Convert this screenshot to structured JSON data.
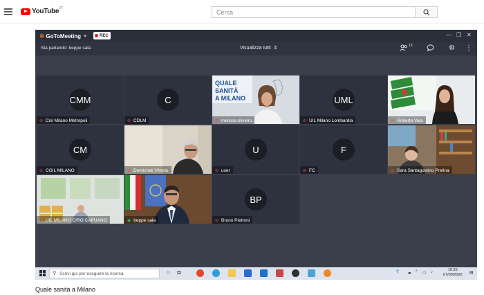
{
  "youtube": {
    "logo_text": "YouTube",
    "country": "IT",
    "search_placeholder": "Cerca",
    "brand_color": "#ff0000"
  },
  "gotomeeting": {
    "app_name": "GoToMeeting",
    "rec_label": "REC",
    "speaking_label": "Sta parlando: beppe sala",
    "view_label": "Visualizza tutti",
    "participant_count": "13",
    "accent": "#f58426"
  },
  "tiles": [
    {
      "name": "Cisl Milano Metropoli",
      "initials": "CMM",
      "mic": "muted",
      "type": "avatar"
    },
    {
      "name": "CDLM",
      "initials": "C",
      "mic": "muted",
      "type": "avatar"
    },
    {
      "name": "melissa oliviero",
      "initials": "",
      "mic": "muted",
      "type": "video"
    },
    {
      "name": "UIL Milano Lombardia",
      "initials": "UML",
      "mic": "muted",
      "type": "avatar"
    },
    {
      "name": "Roberta Vaia",
      "initials": "",
      "mic": "muted",
      "type": "video"
    },
    {
      "name": "CGIL MILANO",
      "initials": "CM",
      "mic": "muted",
      "type": "avatar"
    },
    {
      "name": "Demicheli Vittorio",
      "initials": "",
      "mic": "muted",
      "type": "video"
    },
    {
      "name": "user",
      "initials": "U",
      "mic": "muted",
      "type": "avatar"
    },
    {
      "name": "FC",
      "initials": "F",
      "mic": "muted",
      "type": "avatar"
    },
    {
      "name": "Sara Santagostino Prelina",
      "initials": "",
      "mic": "muted",
      "type": "video"
    },
    {
      "name": "UIL MILANO CIRO CAPUANO",
      "initials": "",
      "mic": "muted",
      "type": "video"
    },
    {
      "name": "beppe sala",
      "initials": "",
      "mic": "on",
      "type": "video"
    },
    {
      "name": "Bruno Pietroni",
      "initials": "BP",
      "mic": "muted",
      "type": "avatar"
    }
  ],
  "banner": {
    "line1": "QUALE",
    "line2": "SANITÀ",
    "line3": "A MILANO"
  },
  "taskbar": {
    "search_placeholder": "Scrivi qui per eseguire la ricerca",
    "time": "10:35",
    "date": "07/09/2020"
  },
  "caption": "Quale sanità a Milano"
}
